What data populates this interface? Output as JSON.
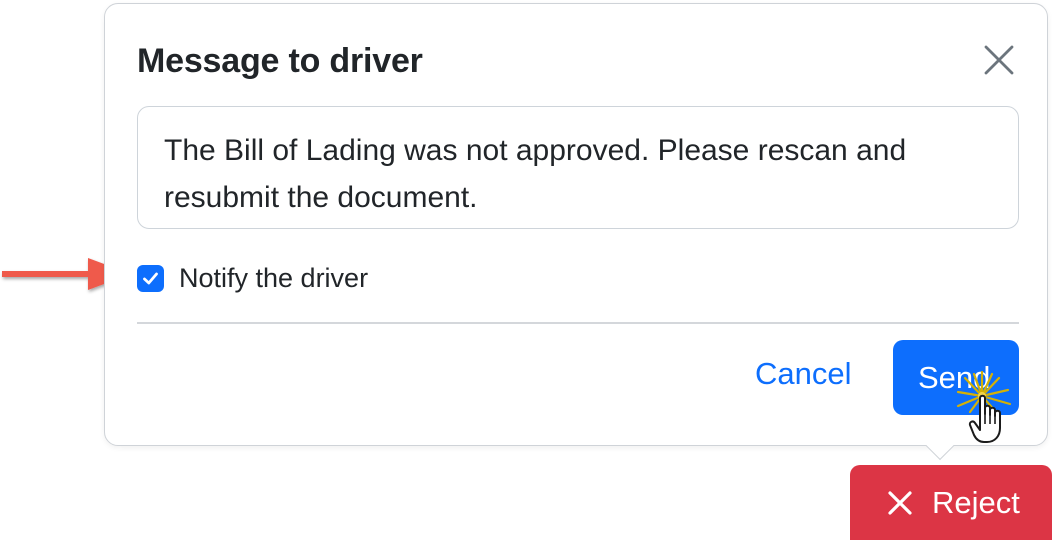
{
  "dialog": {
    "title": "Message to driver",
    "message": "The Bill of Lading was not approved. Please rescan and resubmit the document.",
    "notify_label": "Notify the driver",
    "notify_checked": true,
    "cancel_label": "Cancel",
    "send_label": "Send",
    "close_icon": "close-icon",
    "checkbox_icon": "checkmark-icon"
  },
  "toolbar": {
    "reject_label": "Reject",
    "reject_icon": "x-icon"
  },
  "annotations": {
    "arrow_color": "#ef5a4b",
    "pointer_icon": "hand-pointer-icon",
    "click_burst_color": "#d4b106"
  },
  "colors": {
    "primary": "#0d6efd",
    "danger": "#dc3545",
    "text": "#212529",
    "border": "#ced4da"
  }
}
